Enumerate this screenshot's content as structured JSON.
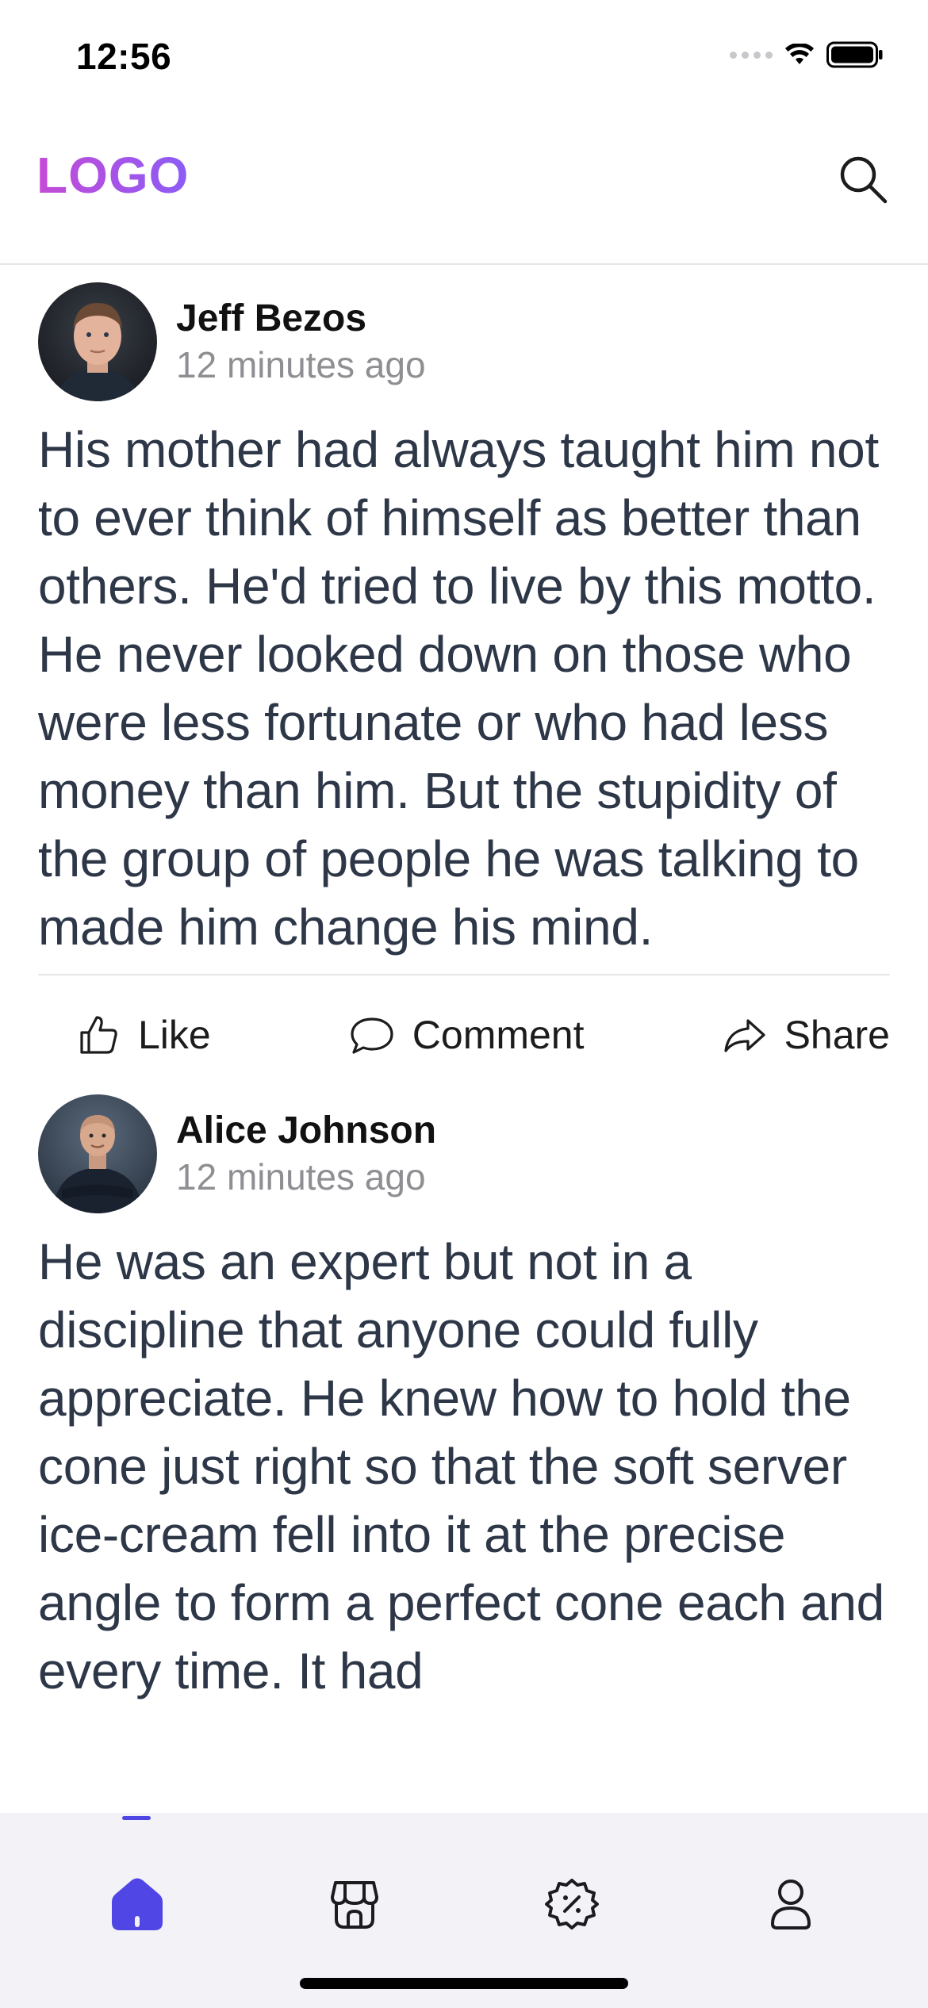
{
  "status_bar": {
    "time": "12:56"
  },
  "header": {
    "logo": "LOGO",
    "search_icon": "search-icon"
  },
  "posts": [
    {
      "author": "Jeff Bezos",
      "time": "12 minutes ago",
      "text": "His mother had always taught him not to ever think of himself as better than others. He'd tried to live by this motto. He never looked down on those who were less fortunate or who had less money than him. But the stupidity of the group of people he was talking to made him change his mind.",
      "actions": {
        "like": "Like",
        "comment": "Comment",
        "share": "Share"
      }
    },
    {
      "author": "Alice Johnson",
      "time": "12 minutes ago",
      "text": "He was an expert but not in a discipline that anyone could fully appreciate. He knew how to hold the cone just right so that the soft server ice-cream fell into it at the precise angle to form a perfect cone each and every time. It had"
    }
  ],
  "tabbar": {
    "items": [
      {
        "icon": "home-icon",
        "active": true
      },
      {
        "icon": "store-icon",
        "active": false
      },
      {
        "icon": "discount-badge-icon",
        "active": false
      },
      {
        "icon": "profile-icon",
        "active": false
      }
    ],
    "active_color": "#4f46e5",
    "inactive_color": "#1c1c1e"
  },
  "colors": {
    "logo_start": "#c44bd6",
    "logo_end": "#8b5cf6",
    "body_text": "#2d3748",
    "muted": "#8e8e93"
  }
}
